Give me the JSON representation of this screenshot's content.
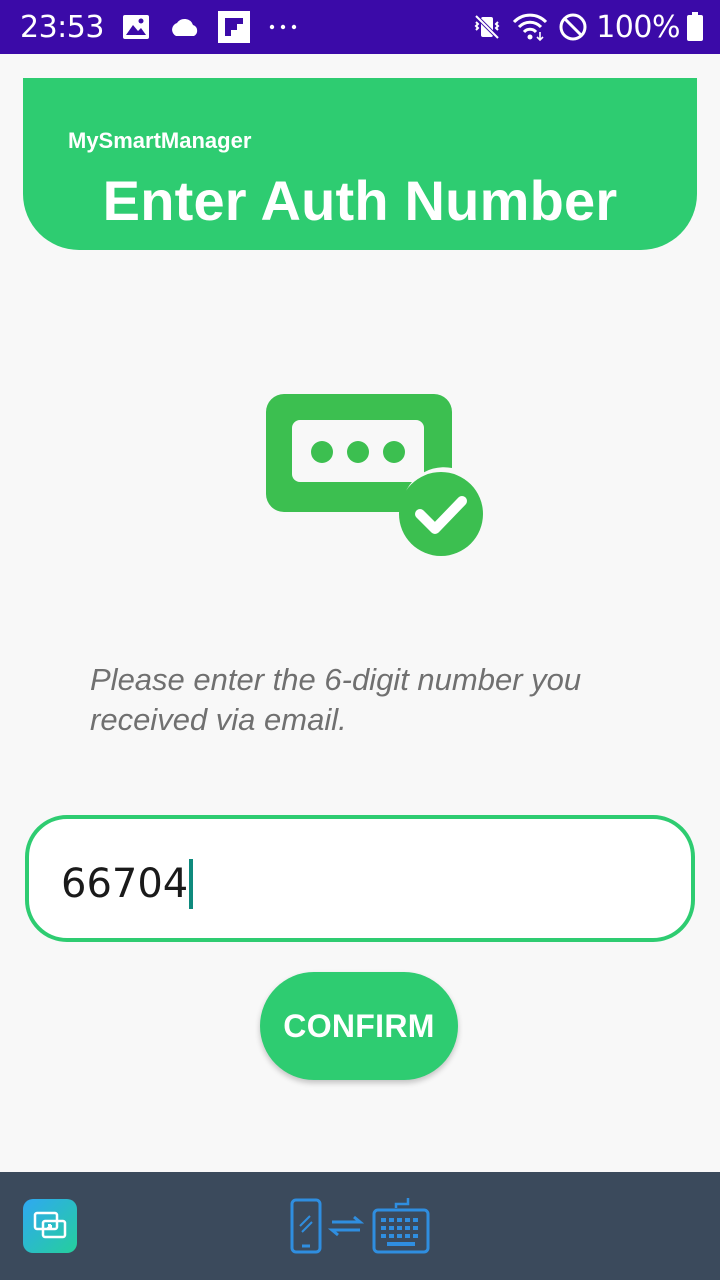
{
  "status_bar": {
    "time": "23:53",
    "battery": "100%",
    "icons_left": [
      "image-icon",
      "cloud-icon",
      "flipboard-icon",
      "more-dots-icon"
    ],
    "icons_right": [
      "vibrate-mute-icon",
      "wifi-icon",
      "do-not-disturb-icon",
      "battery-icon"
    ]
  },
  "header": {
    "app_name": "MySmartManager",
    "title": "Enter Auth Number"
  },
  "auth_icon": "message-check-icon",
  "instruction": "Please enter the 6-digit number you received via email.",
  "code_input": {
    "value": "66704"
  },
  "confirm_button": {
    "label": "CONFIRM"
  },
  "bottom_bar": {
    "left_icon": "screen-mirror-icon",
    "center_icon": "phone-keyboard-switch-icon"
  },
  "colors": {
    "accent": "#2ecc71",
    "status_bar": "#3b0aa8",
    "bottom_bar": "#3b4a5c",
    "background": "#f8f8f8",
    "instruction_text": "#707070"
  }
}
